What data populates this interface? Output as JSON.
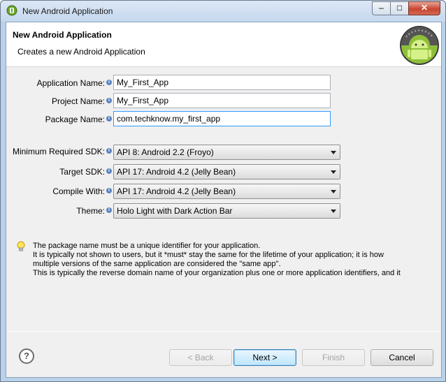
{
  "window": {
    "title": "New Android Application",
    "minimize_glyph": "–",
    "maximize_glyph": "□",
    "close_glyph": "✕"
  },
  "header": {
    "title": "New Android Application",
    "subtitle": "Creates a new Android Application"
  },
  "form": {
    "app_name_label": "Application Name:",
    "app_name_value": "My_First_App",
    "project_name_label": "Project Name:",
    "project_name_value": "My_First_App",
    "package_name_label": "Package Name:",
    "package_name_value": "com.techknow.my_first_app",
    "min_sdk_label": "Minimum Required SDK:",
    "min_sdk_value": "API 8: Android 2.2 (Froyo)",
    "target_sdk_label": "Target SDK:",
    "target_sdk_value": "API 17: Android 4.2 (Jelly Bean)",
    "compile_with_label": "Compile With:",
    "compile_with_value": "API 17: Android 4.2 (Jelly Bean)",
    "theme_label": "Theme:",
    "theme_value": "Holo Light with Dark Action Bar",
    "info_glyph": "i"
  },
  "hint": {
    "lines": [
      "The package name must be a unique identifier for your application.",
      "It is typically not shown to users, but it *must* stay the same for the lifetime of your application; it is how",
      "multiple versions of the same application are considered the \"same app\".",
      "This is typically the reverse domain name of your organization plus one or more application identifiers, and it"
    ]
  },
  "footer": {
    "help_glyph": "?",
    "back_label": "< Back",
    "next_label": "Next >",
    "finish_label": "Finish",
    "cancel_label": "Cancel"
  },
  "colors": {
    "title_bar": "#c6d8ee",
    "android_green": "#a4c639",
    "close_button": "#c8452f"
  }
}
